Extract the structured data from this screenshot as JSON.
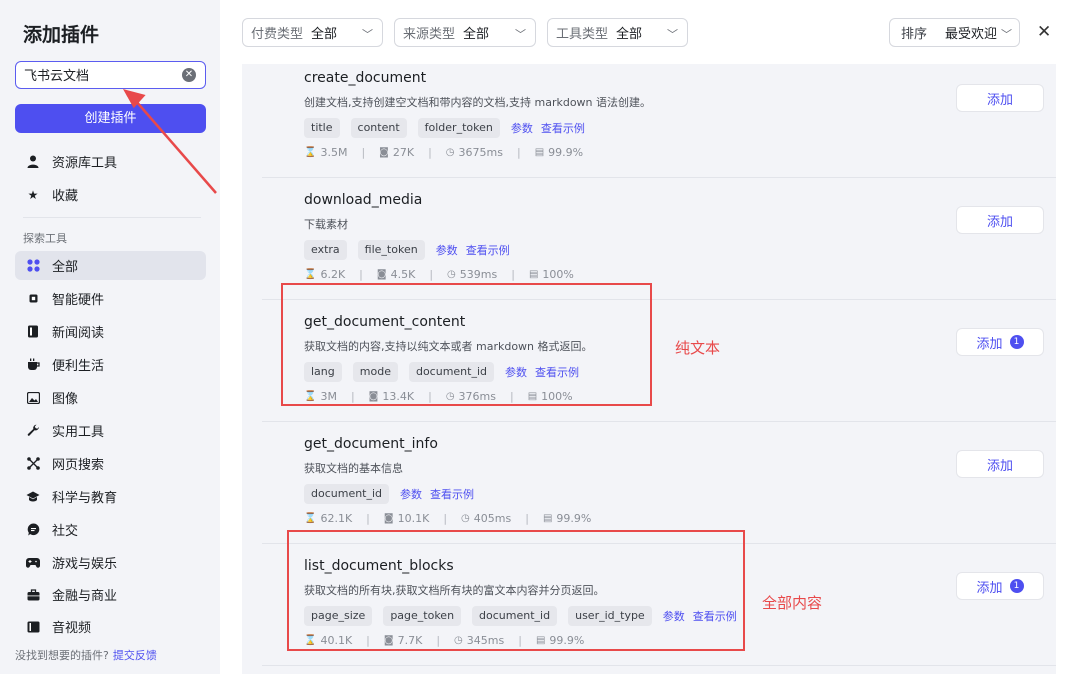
{
  "sidebar": {
    "title": "添加插件",
    "search_value": "飞书云文档",
    "create_label": "创建插件",
    "top_items": [
      {
        "label": "资源库工具",
        "icon": "user-icon"
      },
      {
        "label": "收藏",
        "icon": "star-icon"
      }
    ],
    "section_label": "探索工具",
    "categories": [
      {
        "label": "全部",
        "icon": "grid-icon",
        "active": true
      },
      {
        "label": "智能硬件",
        "icon": "chip-icon"
      },
      {
        "label": "新闻阅读",
        "icon": "book-icon"
      },
      {
        "label": "便利生活",
        "icon": "cup-icon"
      },
      {
        "label": "图像",
        "icon": "image-icon"
      },
      {
        "label": "实用工具",
        "icon": "wrench-icon"
      },
      {
        "label": "网页搜索",
        "icon": "network-icon"
      },
      {
        "label": "科学与教育",
        "icon": "graduation-cap-icon"
      },
      {
        "label": "社交",
        "icon": "chat-icon"
      },
      {
        "label": "游戏与娱乐",
        "icon": "gamepad-icon"
      },
      {
        "label": "金融与商业",
        "icon": "briefcase-icon"
      },
      {
        "label": "音视频",
        "icon": "media-icon"
      }
    ],
    "footer_text": "没找到想要的插件?",
    "footer_link": "提交反馈"
  },
  "filters": {
    "pay": {
      "label": "付费类型",
      "value": "全部"
    },
    "source": {
      "label": "来源类型",
      "value": "全部"
    },
    "tool": {
      "label": "工具类型",
      "value": "全部"
    },
    "sort": {
      "label": "排序",
      "value": "最受欢迎"
    }
  },
  "tools": [
    {
      "name": "create_document",
      "desc": "创建文档,支持创建空文档和带内容的文档,支持 markdown 语法创建。",
      "tags": [
        "title",
        "content",
        "folder_token"
      ],
      "params_label": "参数",
      "example_label": "查看示例",
      "stats": {
        "calls": "3.5M",
        "bots": "27K",
        "latency": "3675ms",
        "success": "99.9%"
      },
      "add_label": "添加",
      "badge": ""
    },
    {
      "name": "download_media",
      "desc": "下载素材",
      "tags": [
        "extra",
        "file_token"
      ],
      "params_label": "参数",
      "example_label": "查看示例",
      "stats": {
        "calls": "6.2K",
        "bots": "4.5K",
        "latency": "539ms",
        "success": "100%"
      },
      "add_label": "添加",
      "badge": ""
    },
    {
      "name": "get_document_content",
      "desc": "获取文档的内容,支持以纯文本或者 markdown 格式返回。",
      "tags": [
        "lang",
        "mode",
        "document_id"
      ],
      "params_label": "参数",
      "example_label": "查看示例",
      "stats": {
        "calls": "3M",
        "bots": "13.4K",
        "latency": "376ms",
        "success": "100%"
      },
      "add_label": "添加",
      "badge": "1"
    },
    {
      "name": "get_document_info",
      "desc": "获取文档的基本信息",
      "tags": [
        "document_id"
      ],
      "params_label": "参数",
      "example_label": "查看示例",
      "stats": {
        "calls": "62.1K",
        "bots": "10.1K",
        "latency": "405ms",
        "success": "99.9%"
      },
      "add_label": "添加",
      "badge": ""
    },
    {
      "name": "list_document_blocks",
      "desc": "获取文档的所有块,获取文档所有块的富文本内容并分页返回。",
      "tags": [
        "page_size",
        "page_token",
        "document_id",
        "user_id_type"
      ],
      "params_label": "参数",
      "example_label": "查看示例",
      "stats": {
        "calls": "40.1K",
        "bots": "7.7K",
        "latency": "345ms",
        "success": "99.9%"
      },
      "add_label": "添加",
      "badge": "1"
    }
  ],
  "annotations": {
    "plain_text": "纯文本",
    "full_content": "全部内容"
  },
  "colors": {
    "accent": "#4e4ff0",
    "annotation_red": "#e8494a",
    "sidebar_bg": "#f3f4f8"
  }
}
